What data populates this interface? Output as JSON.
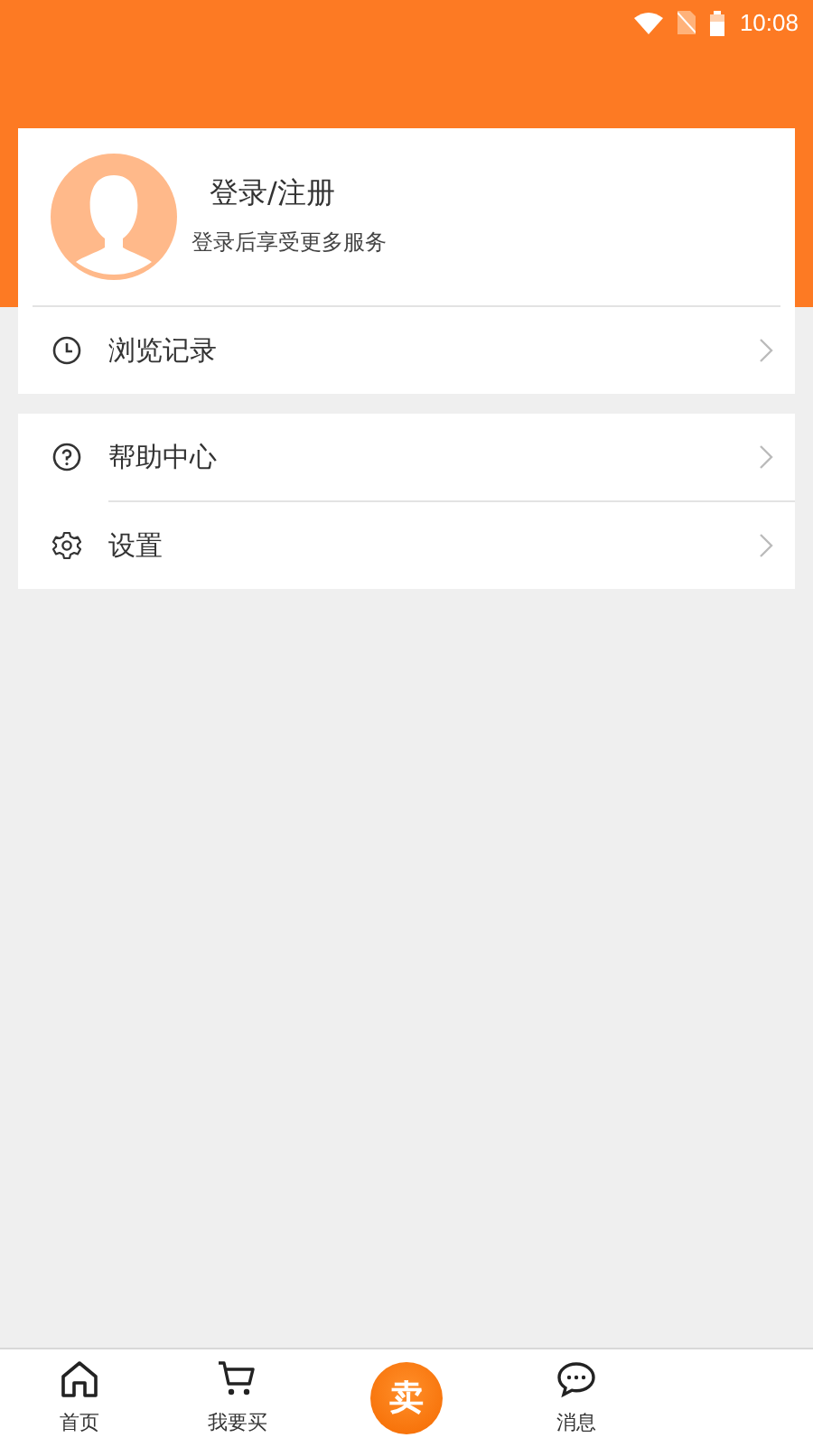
{
  "status_bar": {
    "time": "10:08"
  },
  "profile": {
    "title": "登录/注册",
    "subtitle": "登录后享受更多服务"
  },
  "groups": [
    [
      {
        "label": "浏览记录",
        "kind": "clock"
      }
    ],
    [
      {
        "label": "帮助中心",
        "kind": "help"
      },
      {
        "label": "设置",
        "kind": "settings"
      }
    ]
  ],
  "tabs": [
    {
      "label": "首页",
      "kind": "home"
    },
    {
      "label": "我要买",
      "kind": "cart"
    },
    {
      "label": "卖",
      "kind": "sell"
    },
    {
      "label": "消息",
      "kind": "chat"
    }
  ]
}
